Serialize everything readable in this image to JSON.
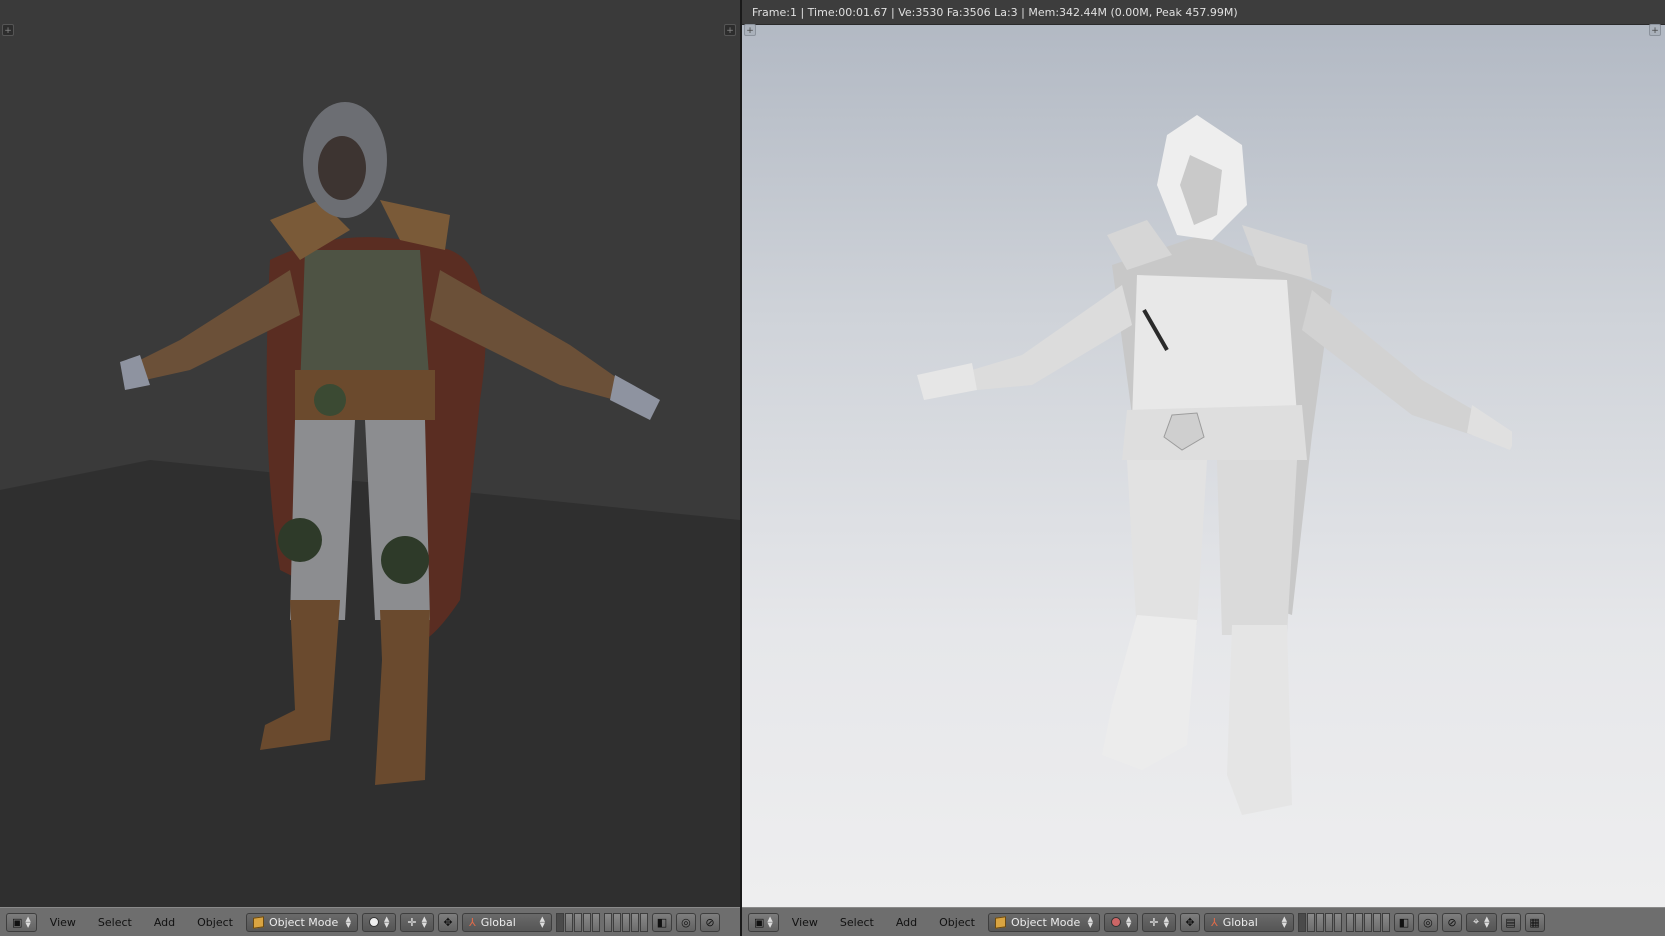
{
  "info_bar": {
    "text": "Frame:1 | Time:00:01.67 | Ve:3530 Fa:3506 La:3 | Mem:342.44M (0.00M, Peak 457.99M)"
  },
  "viewports": [
    {
      "header": {
        "menus": [
          "View",
          "Select",
          "Add",
          "Object"
        ],
        "mode": "Object Mode",
        "orientation": "Global"
      }
    },
    {
      "header": {
        "menus": [
          "View",
          "Select",
          "Add",
          "Object"
        ],
        "mode": "Object Mode",
        "orientation": "Global"
      }
    }
  ],
  "icons": {
    "corner": "+",
    "editor_type": "viewport-icon",
    "shading": "solid-sphere-icon",
    "pivot": "pivot-icon",
    "manipulator": "manipulator-icon",
    "render": "render-icon"
  },
  "colors": {
    "header_bg": "#6e6e6e",
    "viewport_dark": "#3a3a3a",
    "object_mode_icon": "#d9a441"
  }
}
